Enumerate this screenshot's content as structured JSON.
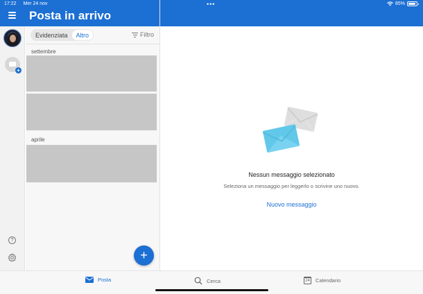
{
  "status_bar": {
    "time": "17:22",
    "date": "Mer 24 nov",
    "battery": "85%"
  },
  "header": {
    "title": "Posta in arrivo"
  },
  "list": {
    "tabs": [
      {
        "label": "Evidenziata",
        "selected": false
      },
      {
        "label": "Altro",
        "selected": true
      }
    ],
    "filter_label": "Filtro",
    "sections": [
      {
        "label": "settembre"
      },
      {
        "label": "aprile"
      }
    ]
  },
  "reading_pane": {
    "empty_title": "Nessun messaggio selezionato",
    "empty_subtitle": "Seleziona un messaggio per leggerlo o scrivine uno nuovo.",
    "new_message_link": "Nuovo messaggio"
  },
  "tabbar": {
    "items": [
      {
        "label": "Posta",
        "icon": "mail-icon",
        "active": true
      },
      {
        "label": "Cerca",
        "icon": "search-icon",
        "active": false
      },
      {
        "label": "Calendario",
        "icon": "calendar-icon",
        "active": false,
        "icon_text": "24"
      }
    ]
  },
  "colors": {
    "accent": "#1c6fd3",
    "placeholder_gray": "#c6c6c6"
  }
}
